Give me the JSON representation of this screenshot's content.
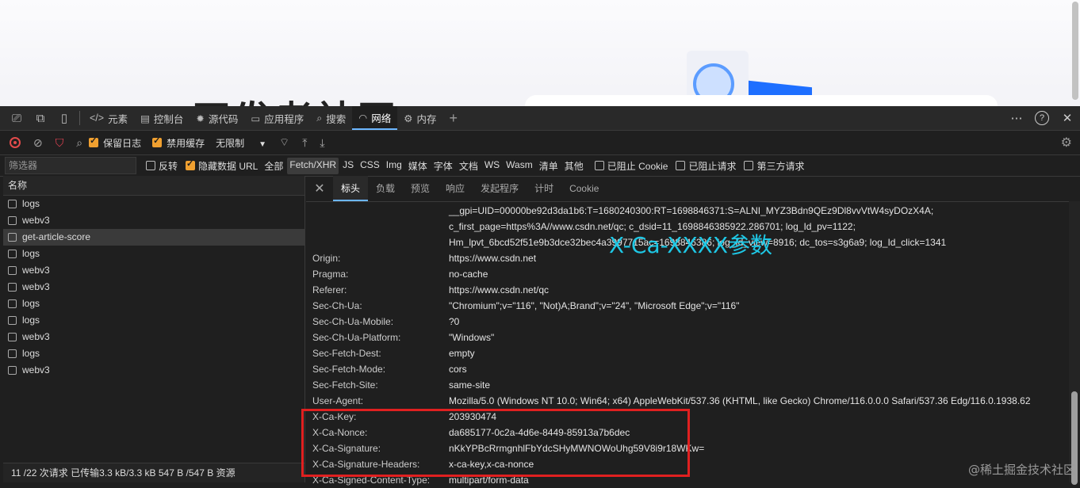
{
  "page": {
    "logo_text": "CSDN 开发者社区",
    "logo_color": "#fc5531"
  },
  "tabbar": {
    "tabs": [
      {
        "icon": "code-icon",
        "glyph": "</>",
        "label": "元素"
      },
      {
        "icon": "console-icon",
        "glyph": "▤",
        "label": "控制台"
      },
      {
        "icon": "bug-icon",
        "glyph": "✹",
        "label": "源代码"
      },
      {
        "icon": "application-icon",
        "glyph": "▭",
        "label": "应用程序"
      },
      {
        "icon": "search-icon",
        "glyph": "⌕",
        "label": "搜索"
      },
      {
        "icon": "wifi-icon",
        "glyph": "◠",
        "label": "网络"
      },
      {
        "icon": "memory-icon",
        "glyph": "⚙",
        "label": "内存"
      }
    ],
    "active_tab": "网络",
    "add_glyph": "+",
    "more_glyph": "⋯",
    "help_glyph": "?",
    "close_glyph": "✕"
  },
  "toolbar": {
    "preserve_log": "保留日志",
    "disable_cache": "禁用缓存",
    "throttle": "无限制",
    "throttle_arrow": "▼"
  },
  "filterbar": {
    "placeholder": "筛选器",
    "invert": "反转",
    "hide_data_urls": "隐藏数据 URL",
    "types": [
      "全部",
      "Fetch/XHR",
      "JS",
      "CSS",
      "Img",
      "媒体",
      "字体",
      "文档",
      "WS",
      "Wasm",
      "清单",
      "其他"
    ],
    "selected_type": "Fetch/XHR",
    "blocked_cookies": "已阻止 Cookie",
    "blocked_requests": "已阻止请求",
    "third_party": "第三方请求"
  },
  "request_list": {
    "header": "名称",
    "items": [
      "logs",
      "webv3",
      "get-article-score",
      "logs",
      "webv3",
      "webv3",
      "logs",
      "logs",
      "webv3",
      "logs",
      "webv3"
    ],
    "selected_index": 2,
    "status": "11 /22 次请求  已传输3.3 kB/3.3 kB  547 B /547 B 资源"
  },
  "detail_tabs": {
    "tabs": [
      "标头",
      "负载",
      "预览",
      "响应",
      "发起程序",
      "计时",
      "Cookie"
    ],
    "active": "标头"
  },
  "headers": [
    {
      "k": "",
      "v": "__gpi=UID=00000be92d3da1b6:T=1680240300:RT=1698846371:S=ALNI_MYZ3Bdn9QEz9Dl8vvVtW4syDOzX4A;"
    },
    {
      "k": "",
      "v": "c_first_page=https%3A//www.csdn.net/qc; c_dsid=11_1698846385922.286701; log_Id_pv=1122;"
    },
    {
      "k": "",
      "v": "Hm_lpvt_6bcd52f51e9b3dce32bec4a3997715ac=1698846386; log_Id_view=8916; dc_tos=s3g6a9; log_Id_click=1341"
    },
    {
      "k": "Origin:",
      "v": "https://www.csdn.net"
    },
    {
      "k": "Pragma:",
      "v": "no-cache"
    },
    {
      "k": "Referer:",
      "v": "https://www.csdn.net/qc"
    },
    {
      "k": "Sec-Ch-Ua:",
      "v": "\"Chromium\";v=\"116\", \"Not)A;Brand\";v=\"24\", \"Microsoft Edge\";v=\"116\""
    },
    {
      "k": "Sec-Ch-Ua-Mobile:",
      "v": "?0"
    },
    {
      "k": "Sec-Ch-Ua-Platform:",
      "v": "\"Windows\""
    },
    {
      "k": "Sec-Fetch-Dest:",
      "v": "empty"
    },
    {
      "k": "Sec-Fetch-Mode:",
      "v": "cors"
    },
    {
      "k": "Sec-Fetch-Site:",
      "v": "same-site"
    },
    {
      "k": "User-Agent:",
      "v": "Mozilla/5.0 (Windows NT 10.0; Win64; x64) AppleWebKit/537.36 (KHTML, like Gecko) Chrome/116.0.0.0 Safari/537.36 Edg/116.0.1938.62"
    },
    {
      "k": "X-Ca-Key:",
      "v": "203930474"
    },
    {
      "k": "X-Ca-Nonce:",
      "v": "da685177-0c2a-4d6e-8449-85913a7b6dec"
    },
    {
      "k": "X-Ca-Signature:",
      "v": "nKkYPBcRrmgnhlFbYdcSHyMWNOWoUhg59V8i9r18WKw="
    },
    {
      "k": "X-Ca-Signature-Headers:",
      "v": "x-ca-key,x-ca-nonce"
    },
    {
      "k": "X-Ca-Signed-Content-Type:",
      "v": "multipart/form-data"
    }
  ],
  "annotation": {
    "text": "X-Ca-XXXX参数",
    "color": "#1ec8e6",
    "box_color": "#e02020"
  },
  "watermark": "@稀土掘金技术社区"
}
